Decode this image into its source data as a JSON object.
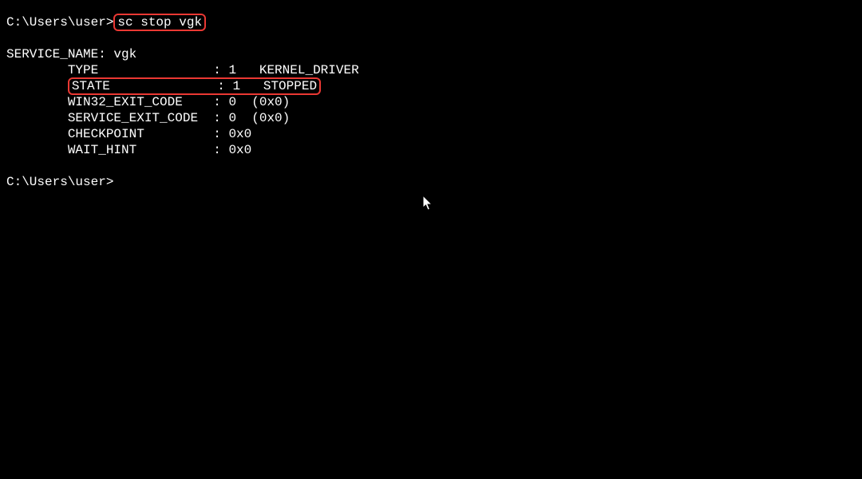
{
  "prompt1Prefix": "C:\\Users\\user>",
  "command": "sc stop vgk",
  "serviceNameLine": "SERVICE_NAME: vgk",
  "rows": {
    "typeLabel": "        TYPE               : 1   KERNEL_DRIVER",
    "statePrefix": "        ",
    "stateContent": "STATE              : 1   STOPPED",
    "win32ExitCodeLine": "        WIN32_EXIT_CODE    : 0  (0x0)",
    "serviceExitCodeLine": "        SERVICE_EXIT_CODE  : 0  (0x0)",
    "checkpointLine": "        CHECKPOINT         : 0x0",
    "waitHintLine": "        WAIT_HINT          : 0x0"
  },
  "prompt2": "C:\\Users\\user>"
}
